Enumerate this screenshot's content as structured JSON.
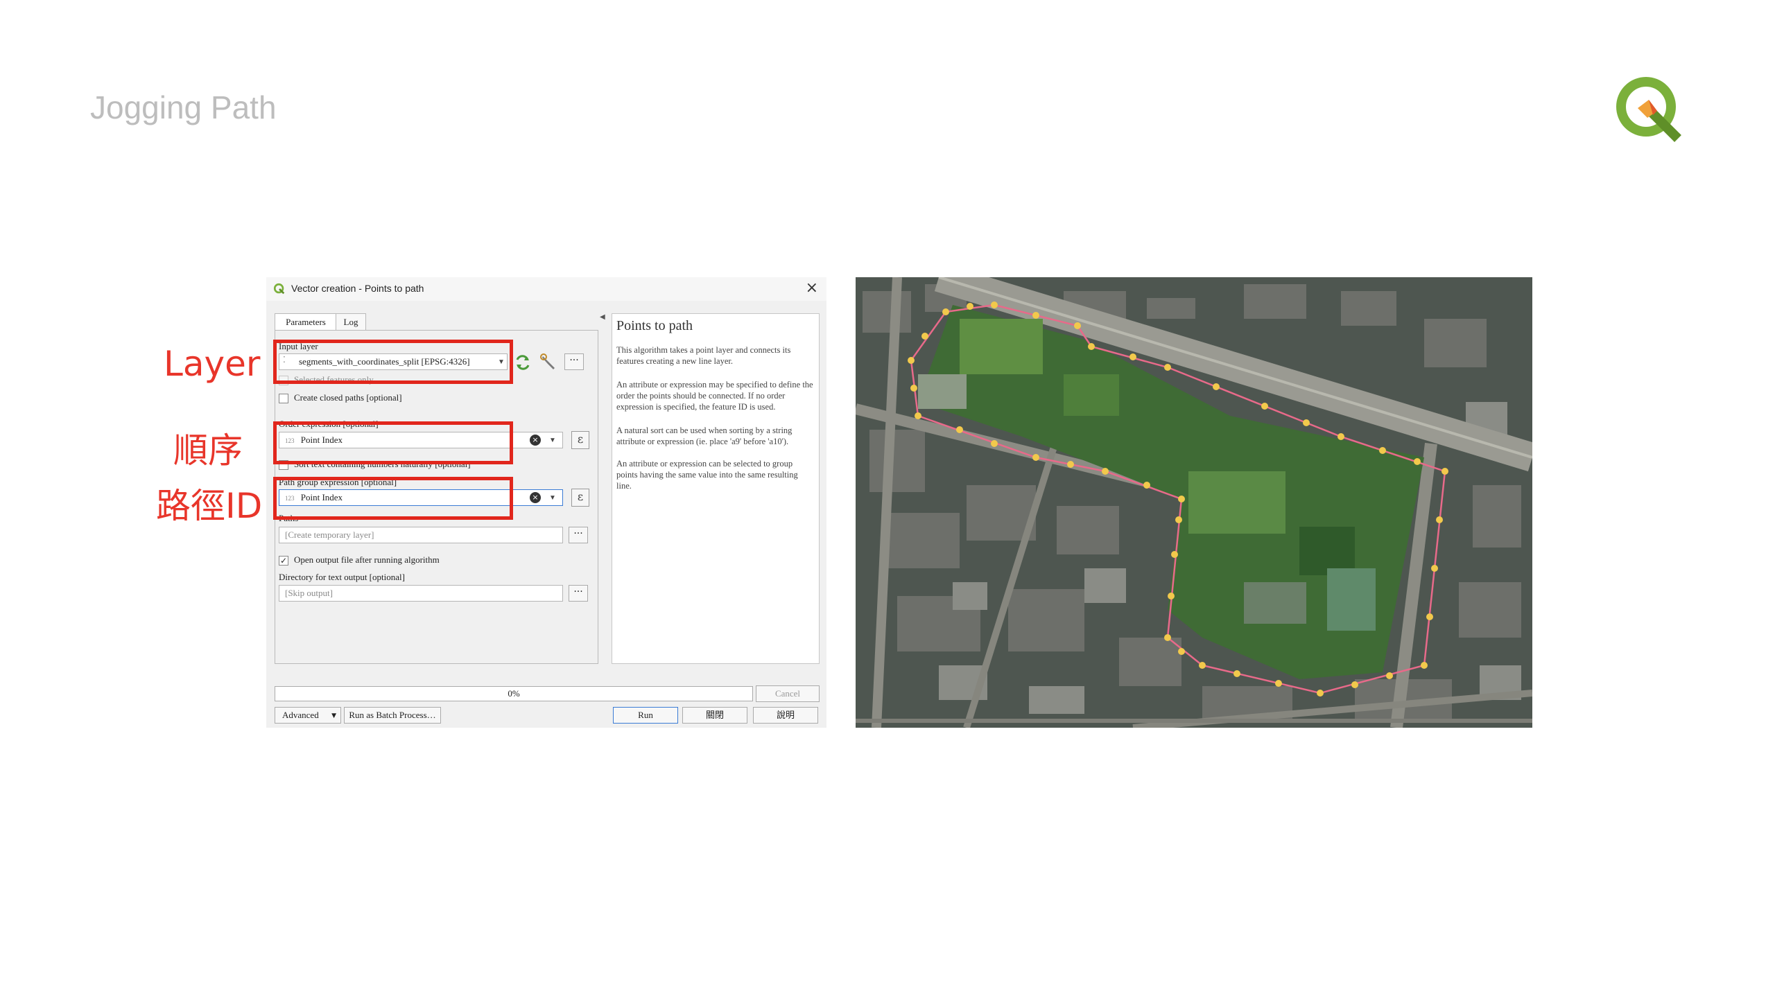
{
  "slide": {
    "title": "Jogging Path"
  },
  "annotations": {
    "layer": "Layer",
    "order": "順序",
    "path_id": "路徑ID"
  },
  "dialog": {
    "title": "Vector creation - Points to path",
    "tabs": [
      "Parameters",
      "Log"
    ],
    "input_layer_label": "Input layer",
    "input_layer_value": "segments_with_coordinates_split [EPSG:4326]",
    "selected_only_label": "Selected features only",
    "closed_paths_label": "Create closed paths [optional]",
    "order_label": "Order expression [optional]",
    "order_value": "Point Index",
    "sort_naturally_label": "Sort text containing numbers naturally [optional]",
    "group_label": "Path group expression [optional]",
    "group_value": "Point Index",
    "paths_label": "Paths",
    "paths_placeholder": "[Create temporary layer]",
    "open_output_label": "Open output file after running algorithm",
    "text_dir_label": "Directory for text output [optional]",
    "text_dir_placeholder": "[Skip output]",
    "expr_prefix": "123",
    "ellipsis": "···",
    "epsilon": "ε",
    "help": {
      "title": "Points to path",
      "p1": "This algorithm takes a point layer and connects its features creating a new line layer.",
      "p2": "An attribute or expression may be specified to define the order the points should be connected. If no order expression is specified, the feature ID is used.",
      "p3": "A natural sort can be used when sorting by a string attribute or expression (ie. place 'a9' before 'a10').",
      "p4": "An attribute or expression can be selected to group points having the same value into the same resulting line."
    },
    "progress_text": "0%",
    "progress": 0,
    "cancel": "Cancel",
    "advanced": "Advanced",
    "batch": "Run as Batch Process…",
    "run": "Run",
    "close": "關閉",
    "help_btn": "說明"
  }
}
